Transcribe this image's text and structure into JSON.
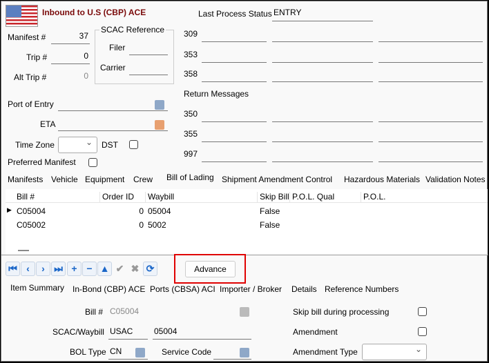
{
  "header": {
    "title": "Inbound to U.S (CBP) ACE"
  },
  "left": {
    "manifest_label": "Manifest #",
    "manifest_value": "37",
    "trip_label": "Trip #",
    "trip_value": "0",
    "alt_trip_label": "Alt Trip #",
    "alt_trip_value": "0",
    "scac_ref_title": "SCAC Reference",
    "filer_label": "Filer",
    "carrier_label": "Carrier",
    "port_label": "Port of Entry",
    "eta_label": "ETA",
    "tz_label": "Time Zone",
    "dst_label": "DST",
    "preferred_label": "Preferred Manifest"
  },
  "status": {
    "last_label": "Last Process Status",
    "last_value": "ENTRY",
    "codes": [
      "309",
      "353",
      "358"
    ],
    "return_label": "Return Messages",
    "return_codes": [
      "350",
      "355",
      "997"
    ]
  },
  "tabs": [
    "Manifests",
    "Vehicle",
    "Equipment",
    "Crew",
    "Bill of Lading",
    "Shipment Amendment Control",
    "Hazardous Materials",
    "Validation Notes"
  ],
  "grid": {
    "headers": [
      "Bill #",
      "Order ID",
      "Waybill",
      "Skip Bill",
      "P.O.L. Qual",
      "P.O.L."
    ],
    "rows": [
      [
        "C05004",
        "0",
        "05004",
        "False",
        "",
        ""
      ],
      [
        "C05002",
        "0",
        "5002",
        "False",
        "",
        ""
      ]
    ]
  },
  "toolbar": {
    "advance_label": "Advance"
  },
  "subtabs": [
    "Item Summary",
    "In-Bond (CBP) ACE",
    "Ports (CBSA) ACI",
    "Importer / Broker",
    "Details",
    "Reference Numbers"
  ],
  "detail": {
    "bill_label": "Bill #",
    "bill_value": "C05004",
    "scac_label": "SCAC/Waybill",
    "scac_value": "USAC",
    "waybill_value": "05004",
    "bol_label": "BOL Type",
    "bol_value": "CN",
    "service_label": "Service Code",
    "skip_label": "Skip bill during processing",
    "amend_label": "Amendment",
    "amend_type_label": "Amendment Type"
  },
  "colors": {
    "title": "#7a0a0a",
    "highlight": "#e00000",
    "icon_blue": "#1a66c8"
  }
}
